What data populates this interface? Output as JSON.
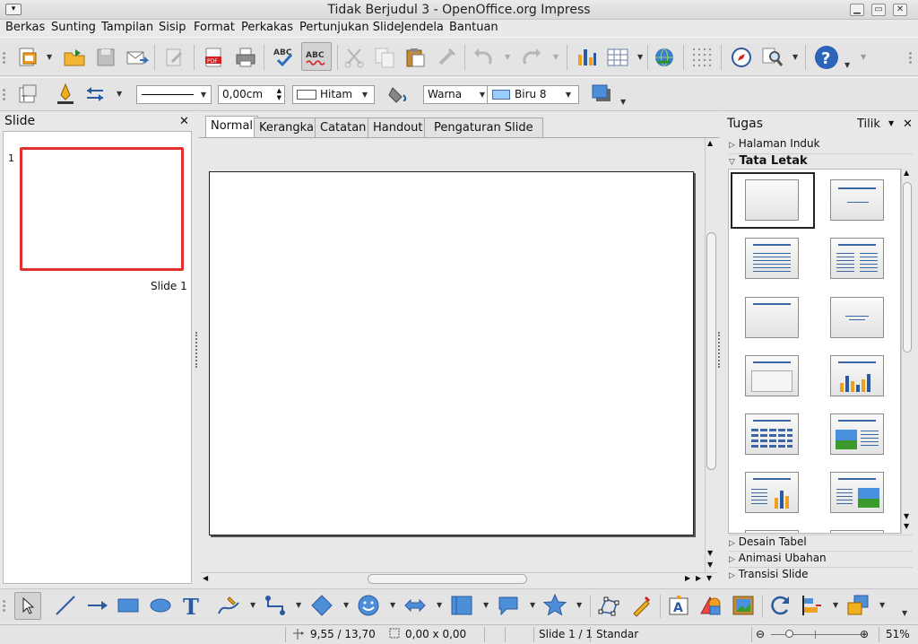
{
  "window": {
    "title": "Tidak Berjudul 3 - OpenOffice.org Impress",
    "menu_icon": "window-menu-icon",
    "controls": [
      "minimize-icon",
      "maximize-icon",
      "close-icon"
    ]
  },
  "menu": [
    "Berkas",
    "Sunting",
    "Tampilan",
    "Sisip",
    "Format",
    "Perkakas",
    "Pertunjukan Slide",
    "Jendela",
    "Bantuan"
  ],
  "line_toolbar": {
    "line_width": "0,00cm",
    "line_color": "Hitam",
    "area_style": "Warna",
    "area_color": "Biru 8",
    "swatch_black": "#000000",
    "swatch_blue": "#99ccff"
  },
  "slides_pane": {
    "title": "Slide",
    "close_glyph": "✕",
    "slide_number": "1",
    "slide_label": "Slide 1",
    "selection_color": "#e03030"
  },
  "view_tabs": [
    "Normal",
    "Kerangka",
    "Catatan",
    "Handout",
    "Pengaturan Slide"
  ],
  "active_tab": "Normal",
  "tasks": {
    "title": "Tugas",
    "view_label": "Tilik",
    "close_glyph": "✕",
    "sections": [
      "Halaman Induk",
      "Tata Letak",
      "Desain Tabel",
      "Animasi Ubahan",
      "Transisi Slide"
    ],
    "expanded": "Tata Letak",
    "layouts": [
      "blank-slide",
      "title-only",
      "title-content",
      "title-2-content",
      "title-only-2",
      "centered-text",
      "title-blank",
      "title-chart",
      "title-table",
      "title-clipart-text",
      "title-text-chart",
      "title-text-clipart"
    ]
  },
  "status": {
    "position": "9,55 / 13,70",
    "size": "0,00 x 0,00",
    "slide": "Slide 1 / 1",
    "master": "Standar",
    "zoom": "51%"
  },
  "colors": {
    "accent": "#3b66a8",
    "chart_orange": "#f0a020",
    "chart_blue": "#2c5aa0"
  }
}
